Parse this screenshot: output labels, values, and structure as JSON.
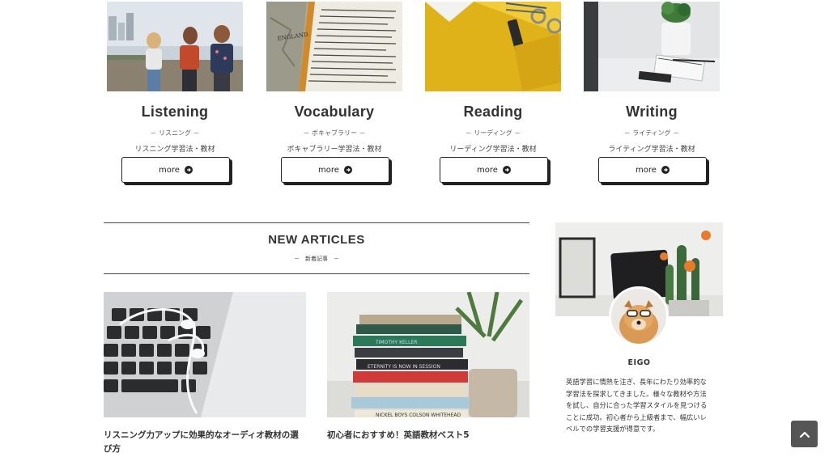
{
  "categories": [
    {
      "title": "Listening",
      "subtitle": "－ リスニング －",
      "description": "リスニング学習法・教材",
      "more_label": "more",
      "image_icon": "friends-walking-photo"
    },
    {
      "title": "Vocabulary",
      "subtitle": "－ ボキャブラリー －",
      "description": "ボキャブラリー学習法・教材",
      "more_label": "more",
      "image_icon": "dictionary-photo"
    },
    {
      "title": "Reading",
      "subtitle": "－ リーディング －",
      "description": "リーディング学習法・教材",
      "more_label": "more",
      "image_icon": "yellow-desk-photo"
    },
    {
      "title": "Writing",
      "subtitle": "－ ライティング －",
      "description": "ライティング学習法・教材",
      "more_label": "more",
      "image_icon": "notebook-photo"
    }
  ],
  "articles_section": {
    "title": "NEW ARTICLES",
    "subtitle": "－　新着記事　－",
    "articles": [
      {
        "title": "リスニング力アップに効果的なオーディオ教材の選び方",
        "image_icon": "laptop-earphones-photo"
      },
      {
        "title": "初心者におすすめ！英語教材ベスト5",
        "image_icon": "book-stack-photo"
      }
    ]
  },
  "profile": {
    "name": "EIGO",
    "bio": "英語学習に情熱を注ぎ、長年にわたり効率的な学習法を探求してきました。様々な教材や方法を試し、自分に合った学習スタイルを見つけることに成功。初心者から上級者まで、幅広いレベルでの学習支援が得意です。"
  },
  "back_to_top_icon": "chevron-up-icon",
  "colors": {
    "text": "#333333",
    "button_border": "#222222",
    "to_top_bg": "#555555"
  }
}
